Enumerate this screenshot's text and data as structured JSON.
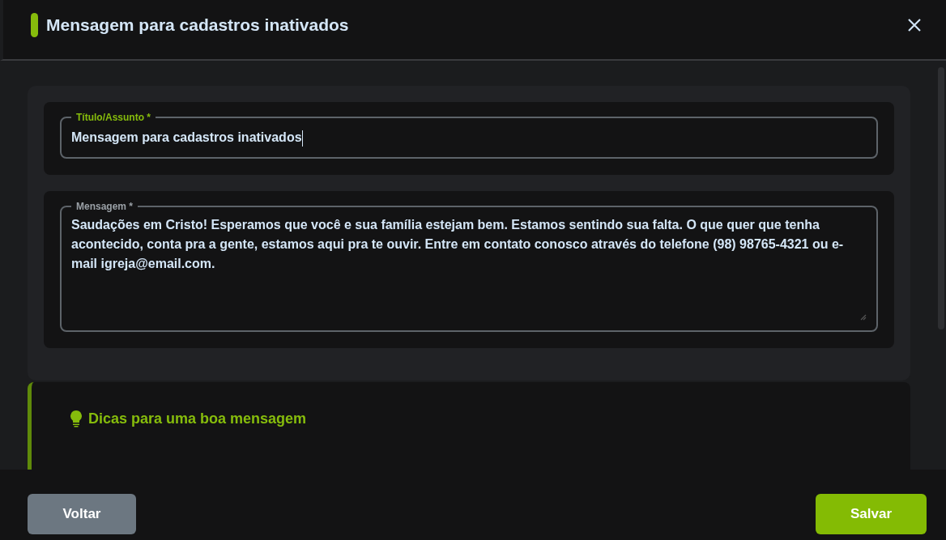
{
  "window": {
    "title": "Mensagem para cadastros inativados"
  },
  "fields": [
    {
      "kind": "input",
      "label": "Título/Assunto *",
      "value": "Mensagem para cadastros inativados",
      "focused": true
    },
    {
      "kind": "textarea",
      "label": "Mensagem *",
      "value": "Saudações em Cristo! Esperamos que você e sua família estejam bem. Estamos sentindo sua falta. O que quer que tenha acontecido, conta pra a gente, estamos aqui pra te ouvir. Entre em contato conosco através do telefone (98) 98765-4321 ou e-mail igreja@email.com.",
      "focused": false
    }
  ],
  "tips": {
    "title": "Dicas para uma boa mensagem"
  },
  "buttons": [
    {
      "kind": "secondary",
      "label": "Voltar"
    },
    {
      "kind": "primary",
      "label": "Salvar"
    }
  ]
}
